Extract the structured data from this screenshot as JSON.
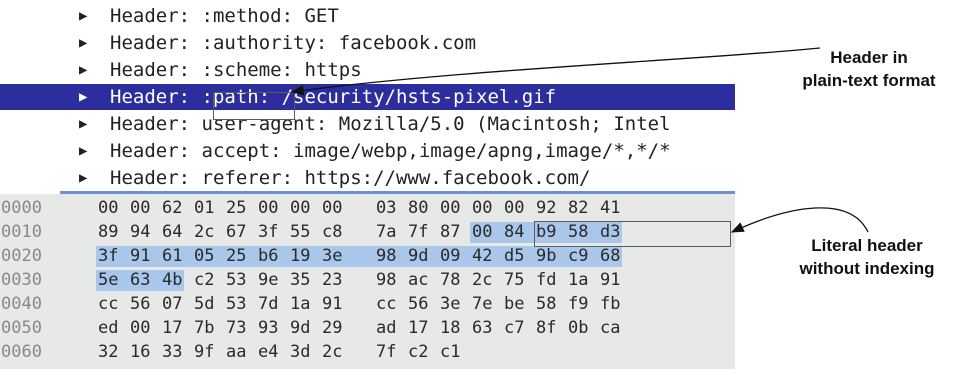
{
  "tree": [
    {
      "text": "Header: :method: GET",
      "selected": false
    },
    {
      "text": "Header: :authority: facebook.com",
      "selected": false
    },
    {
      "text": "Header: :scheme: https",
      "selected": false
    },
    {
      "text": "Header: :path: /security/hsts-pixel.gif",
      "selected": true
    },
    {
      "text": "Header: user-agent: Mozilla/5.0 (Macintosh; Intel",
      "selected": false
    },
    {
      "text": "Header: accept: image/webp,image/apng,image/*,*/*",
      "selected": false
    },
    {
      "text": "Header: referer: https://www.facebook.com/",
      "selected": false
    }
  ],
  "hex": [
    {
      "offset": "0000",
      "bytes": [
        "00",
        "00",
        "62",
        "01",
        "25",
        "00",
        "00",
        "00",
        "03",
        "80",
        "00",
        "00",
        "00",
        "92",
        "82",
        "41"
      ]
    },
    {
      "offset": "0010",
      "bytes": [
        "89",
        "94",
        "64",
        "2c",
        "67",
        "3f",
        "55",
        "c8",
        "7a",
        "7f",
        "87",
        "00",
        "84",
        "b9",
        "58",
        "d3"
      ]
    },
    {
      "offset": "0020",
      "bytes": [
        "3f",
        "91",
        "61",
        "05",
        "25",
        "b6",
        "19",
        "3e",
        "98",
        "9d",
        "09",
        "42",
        "d5",
        "9b",
        "c9",
        "68"
      ]
    },
    {
      "offset": "0030",
      "bytes": [
        "5e",
        "63",
        "4b",
        "c2",
        "53",
        "9e",
        "35",
        "23",
        "98",
        "ac",
        "78",
        "2c",
        "75",
        "fd",
        "1a",
        "91"
      ]
    },
    {
      "offset": "0040",
      "bytes": [
        "cc",
        "56",
        "07",
        "5d",
        "53",
        "7d",
        "1a",
        "91",
        "cc",
        "56",
        "3e",
        "7e",
        "be",
        "58",
        "f9",
        "fb"
      ]
    },
    {
      "offset": "0050",
      "bytes": [
        "ed",
        "00",
        "17",
        "7b",
        "73",
        "93",
        "9d",
        "29",
        "ad",
        "17",
        "18",
        "63",
        "c7",
        "8f",
        "0b",
        "ca"
      ]
    },
    {
      "offset": "0060",
      "bytes": [
        "32",
        "16",
        "33",
        "9f",
        "aa",
        "e4",
        "3d",
        "2c",
        "7f",
        "c2",
        "c1"
      ]
    }
  ],
  "callouts": {
    "plain_text_line1": "Header in",
    "plain_text_line2": "plain-text format",
    "literal_line1": "Literal header",
    "literal_line2": "without indexing"
  },
  "colors": {
    "selected_row": "#2b2e9c",
    "hex_highlight": "#a9c7ea",
    "hex_background": "#e7e8e8"
  }
}
